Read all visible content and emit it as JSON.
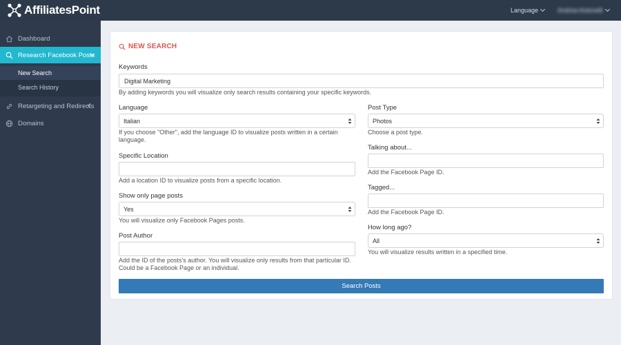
{
  "brand": {
    "name": "AffiliatesPoint"
  },
  "topbar": {
    "language_label": "Language",
    "user_name": "Andrea Antonelli"
  },
  "sidebar": {
    "items": [
      {
        "label": "Dashboard"
      },
      {
        "label": "Research Facebook Posts"
      },
      {
        "label": "Retargeting and Redirects"
      },
      {
        "label": "Domains"
      }
    ],
    "submenu": [
      {
        "label": "New Search"
      },
      {
        "label": "Search History"
      }
    ]
  },
  "form": {
    "title": "NEW SEARCH",
    "keywords": {
      "label": "Keywords",
      "value": "Digital Marketing",
      "help": "By adding keywords you will visualize only search results containing your specific keywords."
    },
    "language": {
      "label": "Language",
      "value": "Italian",
      "help": "If you choose \"Other\", add the language ID to visualize posts written in a certain language."
    },
    "post_type": {
      "label": "Post Type",
      "value": "Photos",
      "help": "Choose a post type."
    },
    "talking_about": {
      "label": "Talking about...",
      "value": "",
      "help": "Add the Facebook Page ID."
    },
    "specific_location": {
      "label": "Specific Location",
      "value": "",
      "help": "Add a location ID to visualize posts from a specific location."
    },
    "tagged": {
      "label": "Tagged...",
      "value": "",
      "help": "Add the Facebook Page ID."
    },
    "page_posts": {
      "label": "Show only page posts",
      "value": "Yes",
      "help": "You will visualize only Facebook Pages posts."
    },
    "how_long": {
      "label": "How long ago?",
      "value": "All",
      "help": "You will visualize results written in a specified time."
    },
    "post_author": {
      "label": "Post Author",
      "value": "",
      "help": "Add the ID of the posts's author. You will visualize only results from that particular ID. Could be a Facebook Page or an individual."
    },
    "submit_label": "Search Posts"
  },
  "colors": {
    "topbar": "#2d3a4a",
    "sidebar": "#2f3b4c",
    "accent": "#22b8cf",
    "title": "#e0544f",
    "button": "#337ab7"
  },
  "icons": {
    "logo": "network-nodes-icon",
    "dashboard": "home-icon",
    "research": "search-icon",
    "retargeting": "link-icon",
    "domains": "globe-icon",
    "title": "search-icon",
    "select": "sort-arrows-icon"
  }
}
